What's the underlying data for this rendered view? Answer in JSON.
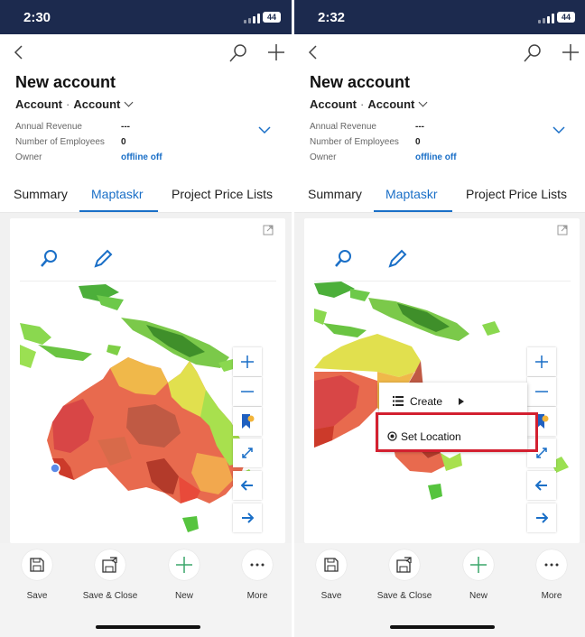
{
  "screens": [
    {
      "status": {
        "time": "2:30",
        "battery": "44"
      },
      "record": {
        "title": "New account",
        "entity": "Account",
        "form": "Account"
      },
      "fields": [
        {
          "label": "Annual Revenue",
          "value": "---"
        },
        {
          "label": "Number of Employees",
          "value": "0"
        },
        {
          "label": "Owner",
          "value": "offline off"
        }
      ],
      "tabs": [
        "Summary",
        "Maptaskr",
        "Project Price Lists"
      ],
      "active_tab": "Maptaskr",
      "actions": [
        "Save",
        "Save & Close",
        "New",
        "More"
      ]
    },
    {
      "status": {
        "time": "2:32",
        "battery": "44"
      },
      "record": {
        "title": "New account",
        "entity": "Account",
        "form": "Account"
      },
      "fields": [
        {
          "label": "Annual Revenue",
          "value": "---"
        },
        {
          "label": "Number of Employees",
          "value": "0"
        },
        {
          "label": "Owner",
          "value": "offline off"
        }
      ],
      "tabs": [
        "Summary",
        "Maptaskr",
        "Project Price Lists"
      ],
      "active_tab": "Maptaskr",
      "actions": [
        "Save",
        "Save & Close",
        "New",
        "More"
      ],
      "context_menu": {
        "items": [
          "Create",
          "Set Location"
        ],
        "highlighted": "Set Location"
      }
    }
  ],
  "colors": {
    "status_bar": "#1c2a4e",
    "accent": "#1a6fc7",
    "highlight_box": "#d32030"
  },
  "icons": [
    "back-arrow-icon",
    "search-icon",
    "plus-icon",
    "chevron-down-icon",
    "popout-icon",
    "pencil-icon",
    "zoom-in-icon",
    "zoom-out-icon",
    "layers-icon",
    "fullscreen-icon",
    "pan-left-icon",
    "pan-right-icon",
    "save-icon",
    "save-close-icon",
    "new-icon",
    "more-icon",
    "list-icon",
    "caret-right-icon",
    "radio-target-icon"
  ]
}
